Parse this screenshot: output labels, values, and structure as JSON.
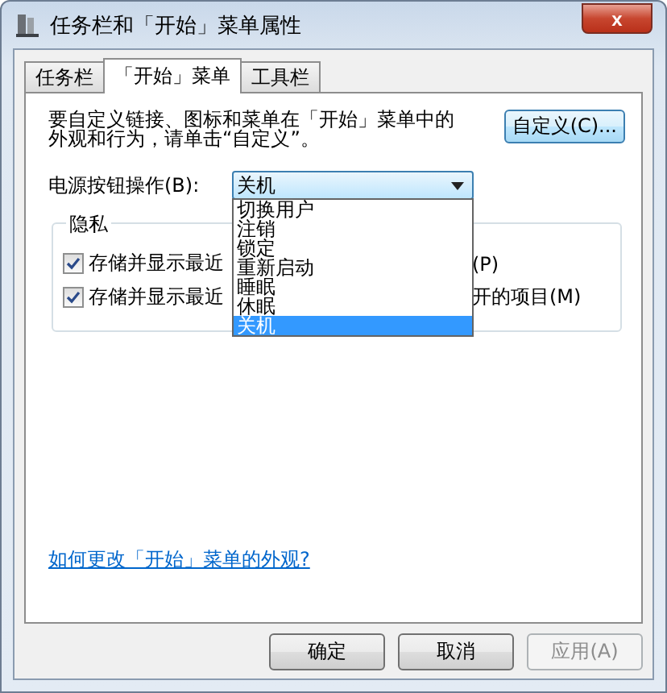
{
  "window": {
    "title": "任务栏和「开始」菜单属性",
    "close": "x"
  },
  "tabs": [
    {
      "label": "任务栏",
      "selected": false
    },
    {
      "label": "「开始」菜单",
      "selected": true
    },
    {
      "label": "工具栏",
      "selected": false
    }
  ],
  "description": "要自定义链接、图标和菜单在「开始」菜单中的外观和行为，请单击“自定义”。",
  "customize_button": "自定义(C)...",
  "power_button": {
    "label": "电源按钮操作(B):",
    "value": "关机",
    "expanded": true,
    "options": [
      {
        "label": "切换用户",
        "selected": false
      },
      {
        "label": "注销",
        "selected": false
      },
      {
        "label": "锁定",
        "selected": false
      },
      {
        "label": "重新启动",
        "selected": false
      },
      {
        "label": "睡眠",
        "selected": false
      },
      {
        "label": "休眠",
        "selected": false
      },
      {
        "label": "关机",
        "selected": true
      }
    ]
  },
  "privacy": {
    "title": "隐私",
    "checkboxes": [
      {
        "label_start": "存储并显示最近",
        "label_end": "(P)",
        "checked": true
      },
      {
        "label_start": "存储并显示最近",
        "label_end": "开的项目(M)",
        "checked": true
      }
    ]
  },
  "help_link": "如何更改「开始」菜单的外观?",
  "buttons": [
    {
      "label": "确定",
      "disabled": false
    },
    {
      "label": "取消",
      "disabled": false
    },
    {
      "label": "应用(A)",
      "disabled": true
    }
  ]
}
